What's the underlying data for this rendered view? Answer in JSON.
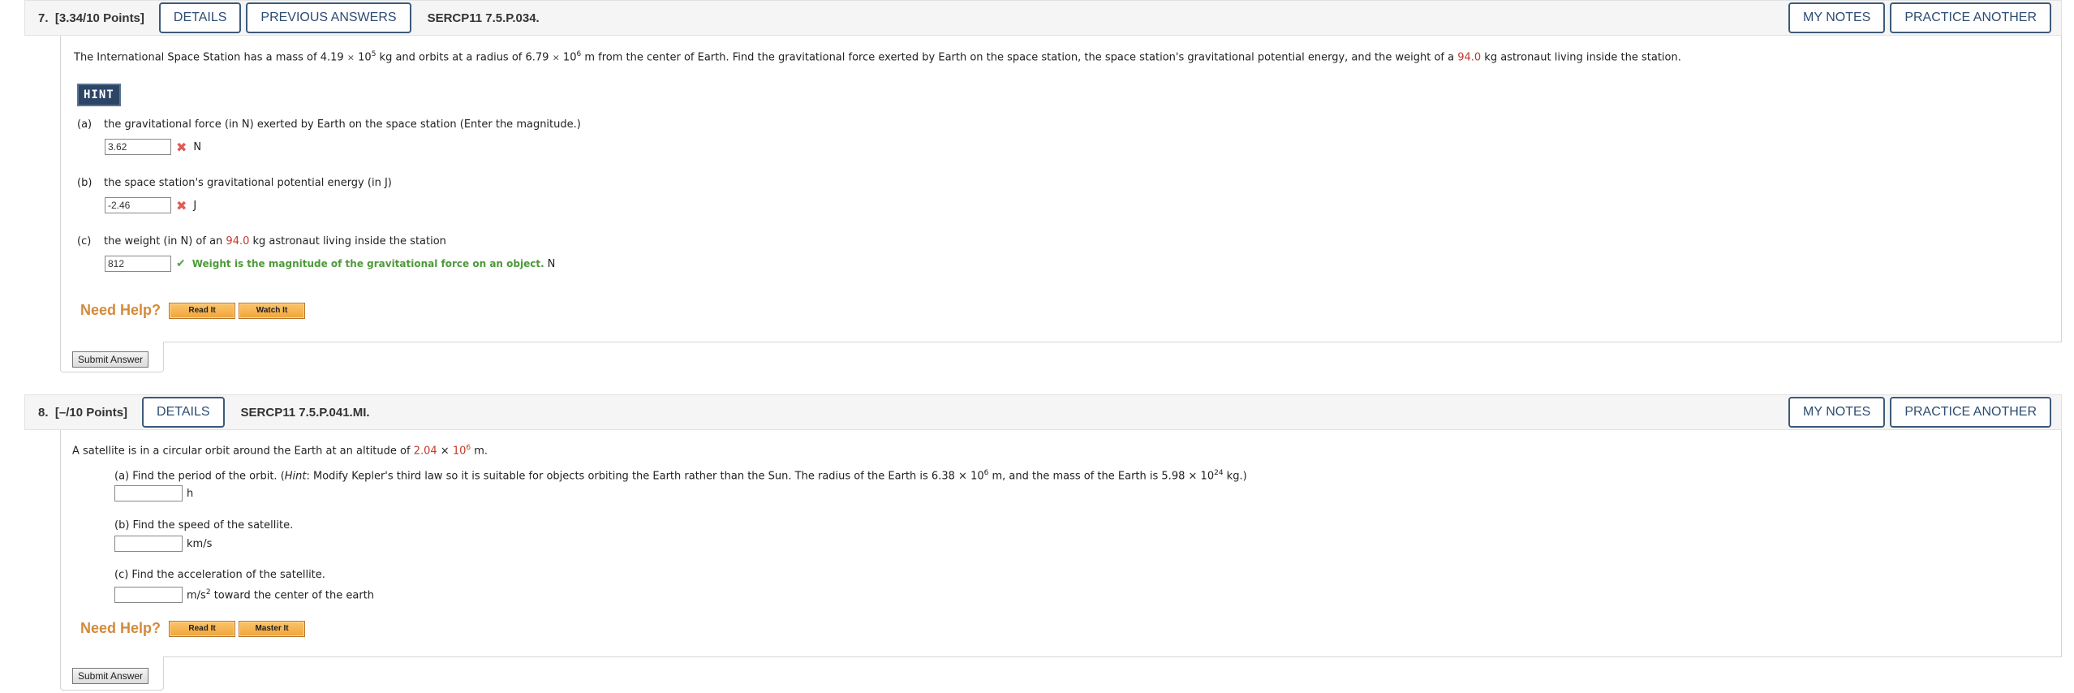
{
  "q7": {
    "number": "7.",
    "points": "[3.34/10 Points]",
    "buttons": {
      "details": "DETAILS",
      "previous_answers": "PREVIOUS ANSWERS",
      "my_notes": "MY NOTES",
      "practice_another": "PRACTICE ANOTHER"
    },
    "code": "SERCP11 7.5.P.034.",
    "stem": {
      "p1": "The International Space Station has a mass of 4.19 ",
      "times": "×",
      "base1": " 10",
      "exp1": "5",
      "p2": " kg and orbits at a radius of 6.79 ",
      "base2": " 10",
      "exp2": "6",
      "p3": " m from the center of Earth. Find the gravitational force exerted by Earth on the space station, the space station's gravitational potential energy, and the weight of a ",
      "mass": "94.0",
      "p4": " kg astronaut living inside the station."
    },
    "hint_label": "HINT",
    "parts": [
      {
        "label": "(a)",
        "text": "the gravitational force (in N) exerted by Earth on the space station (Enter the magnitude.)",
        "value": "3.62",
        "status": "incorrect",
        "unit": "N"
      },
      {
        "label": "(b)",
        "text": "the space station's gravitational potential energy (in J)",
        "value": "-2.46",
        "status": "incorrect",
        "unit": "J"
      },
      {
        "label": "(c)",
        "text_pre": "the weight (in N) of an ",
        "mass": "94.0",
        "text_post": " kg astronaut living inside the station",
        "value": "812",
        "status": "correct",
        "feedback": "Weight is the magnitude of the gravitational force on an object.",
        "unit": "N"
      }
    ],
    "need_help": "Need Help?",
    "help_buttons": [
      "Read It",
      "Watch It"
    ],
    "submit": "Submit Answer"
  },
  "q8": {
    "number": "8.",
    "points": "[–/10 Points]",
    "buttons": {
      "details": "DETAILS",
      "my_notes": "MY NOTES",
      "practice_another": "PRACTICE ANOTHER"
    },
    "code": "SERCP11 7.5.P.041.MI.",
    "stem": {
      "p1": "A satellite is in a circular orbit around the Earth at an altitude of ",
      "alt": "2.04",
      "times": "×",
      "base": "10",
      "exp": "6",
      "p2": " m."
    },
    "parts": [
      {
        "label": "(a)",
        "text_pre": " Find the period of the orbit. (",
        "hint_word": "Hint",
        "text_mid": ": Modify Kepler's third law so it is suitable for objects orbiting the Earth rather than the Sun. The radius of the Earth is 6.38 ",
        "base1": "10",
        "exp1": "6",
        "text_mid2": " m, and the mass of the Earth is 5.98 ",
        "base2": "10",
        "exp2": "24",
        "text_post": " kg.)",
        "value": "",
        "unit": "h"
      },
      {
        "label": "(b)",
        "text": " Find the speed of the satellite.",
        "value": "",
        "unit": "km/s"
      },
      {
        "label": "(c)",
        "text": " Find the acceleration of the satellite.",
        "value": "",
        "unit": "m/s",
        "unit_exp": "2",
        "unit_post": " toward the center of the earth"
      }
    ],
    "need_help": "Need Help?",
    "help_buttons": [
      "Read It",
      "Master It"
    ],
    "submit": "Submit Answer"
  }
}
